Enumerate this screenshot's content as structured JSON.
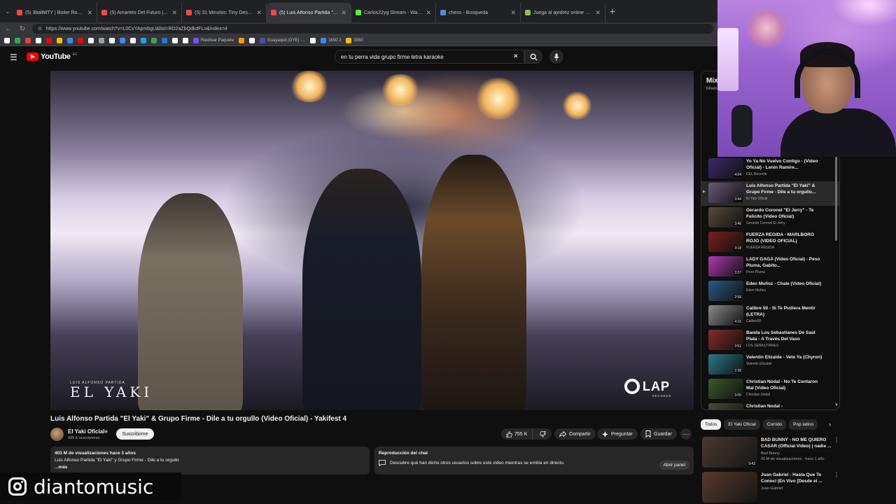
{
  "browser": {
    "tabs": [
      {
        "title": "(5) 3ballMTY | Boiler Room SYSTE",
        "color": "#ff4444",
        "active": false
      },
      {
        "title": "(5) Amantes Del Futuro | Boiler Ro",
        "color": "#ff4444",
        "active": false
      },
      {
        "title": "(5) 31 Minutos: Tiny Desk Concert",
        "color": "#ff4444",
        "active": false
      },
      {
        "title": "(5) Luis Alfonso Partida \"El Yaki\"",
        "color": "#ff4444",
        "active": true
      },
      {
        "title": "Carlos22yg Stream - Watch Li",
        "color": "#53fc18",
        "active": false
      },
      {
        "title": "chess - Búsqueda",
        "color": "#4a90e2",
        "active": false
      },
      {
        "title": "Juega al ajedrez online GRATIS - A",
        "color": "#8bc34a",
        "active": false
      }
    ],
    "url": "https://www.youtube.com/watch?v=L0CvYApmbgU&list=RD2aZbQdkdFLo&index=4",
    "bookmarks": [
      {
        "label": "",
        "color": "#ffffff"
      },
      {
        "label": "",
        "color": "#34a853"
      },
      {
        "label": "",
        "color": "#ea4335"
      },
      {
        "label": "",
        "color": "#ffffff"
      },
      {
        "label": "",
        "color": "#ff0000"
      },
      {
        "label": "",
        "color": "#fbbc05"
      },
      {
        "label": "",
        "color": "#4285f4"
      },
      {
        "label": "",
        "color": "#ff0000"
      },
      {
        "label": "",
        "color": "#ffffff"
      },
      {
        "label": "",
        "color": "#9aa0a6"
      },
      {
        "label": "",
        "color": "#ffffff"
      },
      {
        "label": "",
        "color": "#4285f4"
      },
      {
        "label": "",
        "color": "#ffffff"
      },
      {
        "label": "",
        "color": "#1da1f2"
      },
      {
        "label": "",
        "color": "#34a853"
      },
      {
        "label": "",
        "color": "#1877f2"
      },
      {
        "label": "",
        "color": "#ffffff"
      },
      {
        "label": "",
        "color": "#ffffff"
      },
      {
        "label": "Rastrear Paquete",
        "color": "#7c4dff"
      },
      {
        "label": "",
        "color": "#ff9800"
      },
      {
        "label": "",
        "color": "#ffffff"
      },
      {
        "label": "Guayaquil (GYE) -...",
        "color": "#3f51b5"
      },
      {
        "label": "",
        "color": "#ffffff"
      },
      {
        "label": "1650 2",
        "color": "#4285f4"
      },
      {
        "label": "3060",
        "color": "#fbbc05"
      }
    ]
  },
  "masthead": {
    "logo_text": "YouTube",
    "logo_country": "EC",
    "search_value": "en tu perra vida grupo firme letra karaoke"
  },
  "video": {
    "overlay_small": "LUIS ALFONSO PARTIDA",
    "overlay_big": "EL YAKI",
    "brand": "LAP",
    "brand_sub": "RECORDS",
    "title": "Luis Alfonso Partida \"El Yaki\" & Grupo Firme - Dile a tu orgullo (Video Oficial) - Yakifest 4",
    "channel": "El Yaki Oficial",
    "subs": "985 K suscriptores",
    "subscribe": "Suscribirme",
    "likes": "755 K",
    "share": "Compartir",
    "ask": "Preguntar",
    "save": "Guardar",
    "description": {
      "stats": "403 M de visualizaciones  hace 3 años",
      "line": "Luis Alfonso Partida \"El Yaki\" y Grupo Firme - Dile a tu orgullo",
      "more": "...más"
    },
    "chat": {
      "title": "Reproducción del chat",
      "text": "Descubre qué han dicho otros usuarios sobre este video mientras se emitía en directo.",
      "open": "Abrir panel"
    }
  },
  "mix": {
    "title": "Mix",
    "subtitle": "Mixes",
    "items": [
      {
        "title": "Yo Ya No Vuelvo Contigo - (Video Oficial) - Lenin Ramire...",
        "channel": "DEL Records",
        "duration": "4:04",
        "thumb": "#3b2a6a",
        "now": false,
        "indicator": ""
      },
      {
        "title": "Luis Alfonso Partida \"El Yaki\" & Grupo Firme - Dile a tu orgullo...",
        "channel": "El Yaki Oficial",
        "duration": "3:44",
        "thumb": "#6b5a7a",
        "now": true,
        "indicator": "▶"
      },
      {
        "title": "Gerardo Coronel \"El Jerry\" - Te Felicito (Video Oficial)",
        "channel": "Gerardo Coronel El Jerry",
        "duration": "3:46",
        "thumb": "#5a4a3a",
        "now": false,
        "indicator": ""
      },
      {
        "title": "FUERZA REGIDA - MARLBORO ROJO (VIDEO OFICIAL)",
        "channel": "FUERZA REGIDA",
        "duration": "3:18",
        "thumb": "#7a1f1f",
        "now": false,
        "indicator": ""
      },
      {
        "title": "LADY GAGA (Video Oficial) - Peso Pluma, Gabito...",
        "channel": "Peso Pluma",
        "duration": "3:37",
        "thumb": "#b03ab0",
        "now": false,
        "indicator": ""
      },
      {
        "title": "Eden Muñoz - Chale (Video Oficial)",
        "channel": "Eden Muñoz",
        "duration": "2:58",
        "thumb": "#2a5a8a",
        "now": false,
        "indicator": ""
      },
      {
        "title": "Calibre 50 - Si Te Pudiera Mentir (LETRA)",
        "channel": "Calibre50",
        "duration": "4:16",
        "thumb": "#8a8a8a",
        "now": false,
        "indicator": ""
      },
      {
        "title": "Banda Los Sebastianes De Saúl Plata - A Través Del Vaso",
        "channel": "LOS SEBASTIANES",
        "duration": "3:51",
        "thumb": "#8a2a2a",
        "now": false,
        "indicator": ""
      },
      {
        "title": "Valentin Elizalde - Vete Ya (Chyron)",
        "channel": "Valentin Elizalde",
        "duration": "2:38",
        "thumb": "#2a7a8a",
        "now": false,
        "indicator": ""
      },
      {
        "title": "Christian Nodal - No Te Contaron Mal (Video Oficial)",
        "channel": "Christian Nodal",
        "duration": "3:05",
        "thumb": "#3a5a2a",
        "now": false,
        "indicator": ""
      },
      {
        "title": "Christian Nodal -",
        "channel": "",
        "duration": "",
        "thumb": "#4a4a3a",
        "now": false,
        "indicator": ""
      }
    ]
  },
  "chips": [
    "Todos",
    "El Yaki Oficial",
    "Corrido",
    "Pop latino"
  ],
  "recommended": [
    {
      "title": "BAD BUNNY - NO ME QUIERO CASAR (Official Video) | nadie ...",
      "channel": "Bad Bunny",
      "meta": "41 M de visualizaciones · hace 1 año",
      "duration": "9:43",
      "thumb": "#4a3a30"
    },
    {
      "title": "Juan Gabriel - Hasta Que Te Conocí (En Vivo [Desde el ...",
      "channel": "Juan Gabriel",
      "meta": "",
      "duration": "",
      "thumb": "#5a3a2a"
    }
  ],
  "watermark": "diantomusic",
  "icons": {
    "menu": "hamburger-icon",
    "search": "search-icon",
    "mic": "mic-icon",
    "clear": "close-icon",
    "like": "thumbs-up-icon",
    "dislike": "thumbs-down-icon",
    "share": "share-icon",
    "ask": "sparkle-icon",
    "save": "bookmark-icon",
    "more": "more-vertical-icon",
    "instagram": "instagram-icon",
    "chat": "chat-icon"
  }
}
